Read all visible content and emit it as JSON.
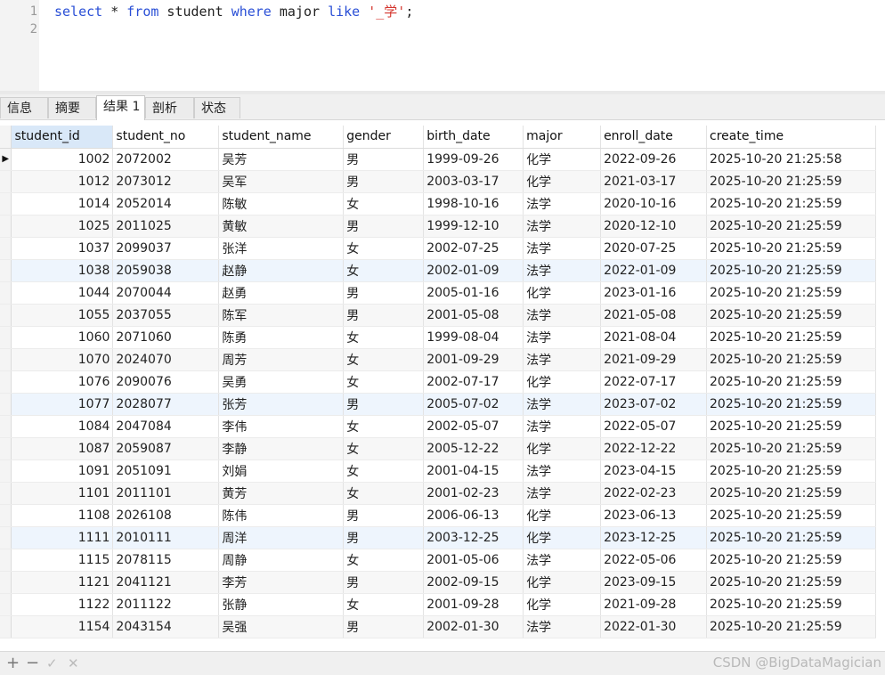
{
  "editor": {
    "lines": [
      {
        "number": "1",
        "tokens": [
          {
            "t": "select",
            "c": "kw"
          },
          {
            "t": " * ",
            "c": ""
          },
          {
            "t": "from",
            "c": "kw"
          },
          {
            "t": " student ",
            "c": ""
          },
          {
            "t": "where",
            "c": "kw"
          },
          {
            "t": " major ",
            "c": ""
          },
          {
            "t": "like",
            "c": "kw"
          },
          {
            "t": " ",
            "c": ""
          },
          {
            "t": "'_学'",
            "c": "str"
          },
          {
            "t": ";",
            "c": ""
          }
        ]
      },
      {
        "number": "2",
        "tokens": []
      }
    ]
  },
  "tabs": [
    {
      "label": "信息",
      "active": false
    },
    {
      "label": "摘要",
      "active": false
    },
    {
      "label": "结果 1",
      "active": true
    },
    {
      "label": "剖析",
      "active": false
    },
    {
      "label": "状态",
      "active": false
    }
  ],
  "table": {
    "columns": [
      "student_id",
      "student_no",
      "student_name",
      "gender",
      "birth_date",
      "major",
      "enroll_date",
      "create_time"
    ],
    "selected_column": "student_id",
    "current_row_marker": "▶",
    "rows": [
      [
        "1002",
        "2072002",
        "吴芳",
        "男",
        "1999-09-26",
        "化学",
        "2022-09-26",
        "2025-10-20 21:25:58"
      ],
      [
        "1012",
        "2073012",
        "吴军",
        "男",
        "2003-03-17",
        "化学",
        "2021-03-17",
        "2025-10-20 21:25:59"
      ],
      [
        "1014",
        "2052014",
        "陈敏",
        "女",
        "1998-10-16",
        "法学",
        "2020-10-16",
        "2025-10-20 21:25:59"
      ],
      [
        "1025",
        "2011025",
        "黄敏",
        "男",
        "1999-12-10",
        "法学",
        "2020-12-10",
        "2025-10-20 21:25:59"
      ],
      [
        "1037",
        "2099037",
        "张洋",
        "女",
        "2002-07-25",
        "法学",
        "2020-07-25",
        "2025-10-20 21:25:59"
      ],
      [
        "1038",
        "2059038",
        "赵静",
        "女",
        "2002-01-09",
        "法学",
        "2022-01-09",
        "2025-10-20 21:25:59"
      ],
      [
        "1044",
        "2070044",
        "赵勇",
        "男",
        "2005-01-16",
        "化学",
        "2023-01-16",
        "2025-10-20 21:25:59"
      ],
      [
        "1055",
        "2037055",
        "陈军",
        "男",
        "2001-05-08",
        "法学",
        "2021-05-08",
        "2025-10-20 21:25:59"
      ],
      [
        "1060",
        "2071060",
        "陈勇",
        "女",
        "1999-08-04",
        "法学",
        "2021-08-04",
        "2025-10-20 21:25:59"
      ],
      [
        "1070",
        "2024070",
        "周芳",
        "女",
        "2001-09-29",
        "法学",
        "2021-09-29",
        "2025-10-20 21:25:59"
      ],
      [
        "1076",
        "2090076",
        "吴勇",
        "女",
        "2002-07-17",
        "化学",
        "2022-07-17",
        "2025-10-20 21:25:59"
      ],
      [
        "1077",
        "2028077",
        "张芳",
        "男",
        "2005-07-02",
        "法学",
        "2023-07-02",
        "2025-10-20 21:25:59"
      ],
      [
        "1084",
        "2047084",
        "李伟",
        "女",
        "2002-05-07",
        "法学",
        "2022-05-07",
        "2025-10-20 21:25:59"
      ],
      [
        "1087",
        "2059087",
        "李静",
        "女",
        "2005-12-22",
        "化学",
        "2022-12-22",
        "2025-10-20 21:25:59"
      ],
      [
        "1091",
        "2051091",
        "刘娟",
        "女",
        "2001-04-15",
        "法学",
        "2023-04-15",
        "2025-10-20 21:25:59"
      ],
      [
        "1101",
        "2011101",
        "黄芳",
        "女",
        "2001-02-23",
        "法学",
        "2022-02-23",
        "2025-10-20 21:25:59"
      ],
      [
        "1108",
        "2026108",
        "陈伟",
        "男",
        "2006-06-13",
        "化学",
        "2023-06-13",
        "2025-10-20 21:25:59"
      ],
      [
        "1111",
        "2010111",
        "周洋",
        "男",
        "2003-12-25",
        "化学",
        "2023-12-25",
        "2025-10-20 21:25:59"
      ],
      [
        "1115",
        "2078115",
        "周静",
        "女",
        "2001-05-06",
        "法学",
        "2022-05-06",
        "2025-10-20 21:25:59"
      ],
      [
        "1121",
        "2041121",
        "李芳",
        "男",
        "2002-09-15",
        "化学",
        "2023-09-15",
        "2025-10-20 21:25:59"
      ],
      [
        "1122",
        "2011122",
        "张静",
        "女",
        "2001-09-28",
        "化学",
        "2021-09-28",
        "2025-10-20 21:25:59"
      ],
      [
        "1154",
        "2043154",
        "吴强",
        "男",
        "2002-01-30",
        "法学",
        "2022-01-30",
        "2025-10-20 21:25:59"
      ]
    ]
  },
  "footer": {
    "add": "+",
    "remove": "−",
    "apply": "✓",
    "cancel": "✕",
    "watermark": "CSDN @BigDataMagician"
  }
}
